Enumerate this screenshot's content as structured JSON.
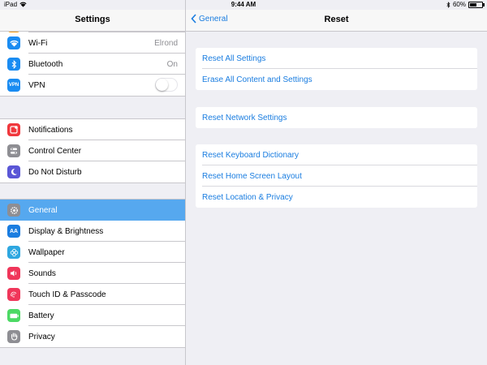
{
  "status": {
    "device": "iPad",
    "time": "9:44 AM",
    "battery": "60%",
    "battery_level": 0.6
  },
  "master": {
    "title": "Settings",
    "groups": [
      [
        {
          "label": "Wi-Fi",
          "value": "Elrond",
          "icon": "wifi-icon",
          "color": "#1a8cf2"
        },
        {
          "label": "Bluetooth",
          "value": "On",
          "icon": "bluetooth-icon",
          "color": "#1a8cf2"
        },
        {
          "label": "VPN",
          "icon": "vpn-icon",
          "color": "#1a8cf2",
          "toggle": "off"
        }
      ],
      [
        {
          "label": "Notifications",
          "icon": "notifications-icon",
          "color": "#f0383d"
        },
        {
          "label": "Control Center",
          "icon": "control-center-icon",
          "color": "#8e8e93"
        },
        {
          "label": "Do Not Disturb",
          "icon": "moon-icon",
          "color": "#5a56d6"
        }
      ],
      [
        {
          "label": "General",
          "icon": "gear-icon",
          "color": "#8e8e93",
          "selected": true
        },
        {
          "label": "Display & Brightness",
          "icon": "display-icon",
          "color": "#1a7de0"
        },
        {
          "label": "Wallpaper",
          "icon": "wallpaper-icon",
          "color": "#2ea7e0"
        },
        {
          "label": "Sounds",
          "icon": "sounds-icon",
          "color": "#f0365a"
        },
        {
          "label": "Touch ID & Passcode",
          "icon": "fingerprint-icon",
          "color": "#f0365a"
        },
        {
          "label": "Battery",
          "icon": "battery-icon",
          "color": "#4cd964"
        },
        {
          "label": "Privacy",
          "icon": "hand-icon",
          "color": "#8e8e93"
        }
      ]
    ]
  },
  "detail": {
    "back_label": "General",
    "title": "Reset",
    "groups": [
      [
        "Reset All Settings",
        "Erase All Content and Settings"
      ],
      [
        "Reset Network Settings"
      ],
      [
        "Reset Keyboard Dictionary",
        "Reset Home Screen Layout",
        "Reset Location & Privacy"
      ]
    ]
  }
}
